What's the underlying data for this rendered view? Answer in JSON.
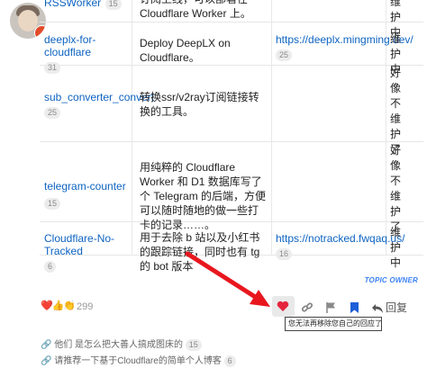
{
  "repos": [
    {
      "name": "RSSWorker",
      "count": "15",
      "desc": "订阅上线，可以部署在 Cloudflare Worker 上。",
      "url": "",
      "url_count": "",
      "status": "维护中"
    },
    {
      "name": "deeplx-for-cloudflare",
      "count": "31",
      "desc": "Deploy DeepLX on Cloudflare。",
      "url": "https://deeplx.mingming.dev/",
      "url_count": "25",
      "status": "维护中"
    },
    {
      "name": "sub_converter_convert",
      "count": "25",
      "desc": "转换ssr/v2ray订阅链接转换的工具。",
      "url": "",
      "url_count": "",
      "status": "好像不维护了"
    },
    {
      "name": "telegram-counter",
      "count": "15",
      "desc": "用纯粹的 Cloudflare Worker 和 D1 数据库写了个 Telegram 的后端，方便可以随时随地的做一些打卡的记录……。",
      "url": "",
      "url_count": "",
      "status": "好像不维护了"
    },
    {
      "name": "Cloudflare-No-Tracked",
      "count": "6",
      "desc": "用于去除 b 站以及小红书的跟踪链接，同时也有 tg 的 bot 版本",
      "url": "https://notracked.fwqaq.us/",
      "url_count": "16",
      "status": "维护中"
    }
  ],
  "topic_owner": "TOPIC OWNER",
  "reactions": {
    "emojis": "❤️👍👏",
    "count": "299"
  },
  "reply_label": "回复",
  "tooltip": "您无法再移除您自己的回应了",
  "linked_topics": [
    "他们 是怎么把大善人搞成图床的",
    "请推荐一下基于Cloudflare的简单个人博客"
  ],
  "linked_counts": [
    "15",
    "6"
  ],
  "icons": [
    "heart-icon",
    "link-icon",
    "flag-icon",
    "bookmark-icon",
    "reply-icon"
  ],
  "colors": {
    "link": "#0d63c2",
    "accent_red": "#e5243d",
    "bookmark": "#1e5fd8",
    "topic_owner": "#3b82f6"
  }
}
